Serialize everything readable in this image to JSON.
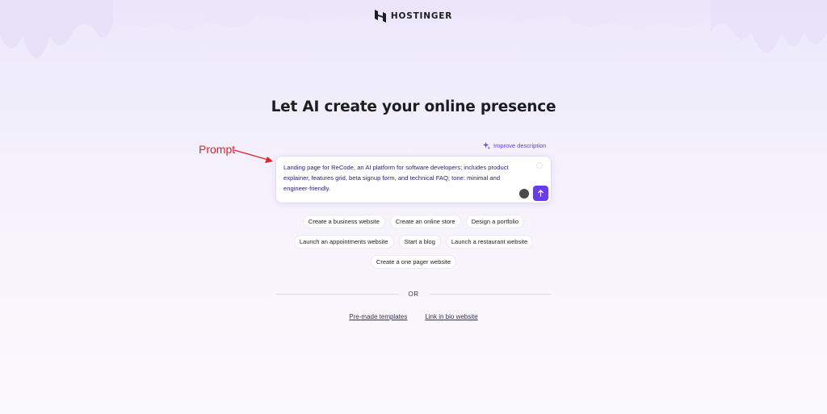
{
  "brand": {
    "name": "HOSTINGER",
    "logo_icon": "hostinger-logo-icon"
  },
  "headline": "Let AI create your online presence",
  "annotation": {
    "label": "Prompt",
    "color": "#e0242f"
  },
  "prompt": {
    "improve_label": "Improve description",
    "value": "Landing page for ReCode, an AI platform for software developers; includes product explainer, features grid, beta signup form, and technical FAQ; tone: minimal and engineer-friendly.",
    "send_icon": "arrow-up-icon",
    "grammar_icon": "grammarly-icon"
  },
  "suggestions": {
    "row1": [
      "Create a business website",
      "Create an online store",
      "Design a portfolio"
    ],
    "row2": [
      "Launch an appointments website",
      "Start a blog",
      "Launch a restaurant website"
    ],
    "row3": [
      "Create a one pager website"
    ]
  },
  "divider_text": "OR",
  "links": {
    "templates": "Pre-made templates",
    "link_in_bio": "Link in bio website"
  },
  "colors": {
    "accent": "#673de6",
    "text": "#1d1e20",
    "background": "#f3f0fc"
  }
}
